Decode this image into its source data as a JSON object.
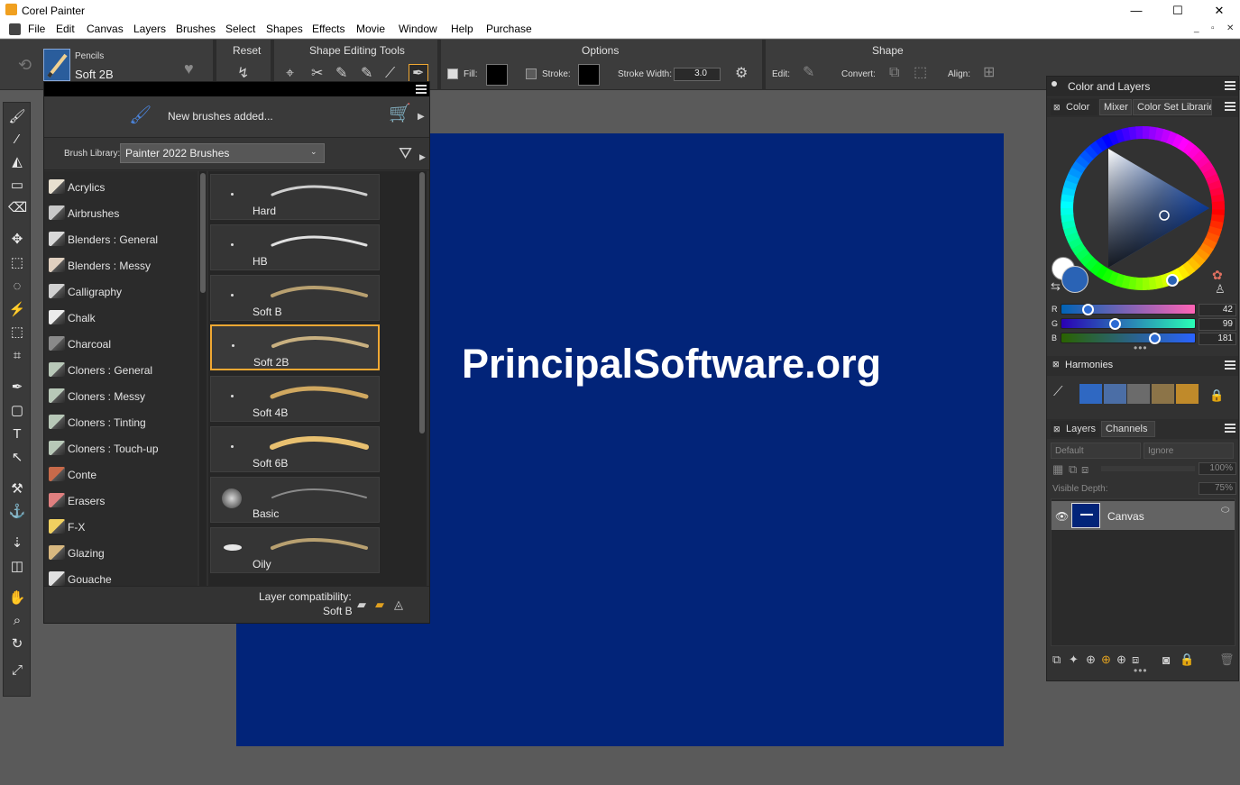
{
  "window": {
    "title": "Corel Painter",
    "minimize": "—",
    "maximize": "☐",
    "close": "✕"
  },
  "menubar": {
    "items": [
      "File",
      "Edit",
      "Canvas",
      "Layers",
      "Brushes",
      "Select",
      "Shapes",
      "Effects",
      "Movie",
      "Window",
      "Help",
      "Purchase"
    ],
    "mdi_buttons": [
      "_",
      "▫",
      "✕"
    ]
  },
  "propbar": {
    "brush_category": "Pencils",
    "brush_variant": "Soft 2B",
    "reset_label": "Reset",
    "shape_tools_label": "Shape Editing Tools",
    "options_label": "Options",
    "fill_label": "Fill:",
    "stroke_label": "Stroke:",
    "stroke_width_label": "Stroke Width:",
    "stroke_width_value": "3.0",
    "shape_label": "Shape",
    "edit_label": "Edit:",
    "convert_label": "Convert:",
    "align_label": "Align:"
  },
  "brush_library": {
    "notice": "New brushes added...",
    "library_label": "Brush Library:",
    "library_value": "Painter 2022 Brushes",
    "categories": [
      {
        "label": "Acrylics",
        "color": "#e8e0d0"
      },
      {
        "label": "Airbrushes",
        "color": "#c8c8c8"
      },
      {
        "label": "Blenders : General",
        "color": "#d8d8d8"
      },
      {
        "label": "Blenders : Messy",
        "color": "#e0d0c0"
      },
      {
        "label": "Calligraphy",
        "color": "#d0d0d0"
      },
      {
        "label": "Chalk",
        "color": "#ececec"
      },
      {
        "label": "Charcoal",
        "color": "#8a8a8a"
      },
      {
        "label": "Cloners : General",
        "color": "#b8c8b8"
      },
      {
        "label": "Cloners : Messy",
        "color": "#b8c8b8"
      },
      {
        "label": "Cloners : Tinting",
        "color": "#b8c8b8"
      },
      {
        "label": "Cloners : Touch-up",
        "color": "#b8c8b8"
      },
      {
        "label": "Conte",
        "color": "#c86a4a"
      },
      {
        "label": "Erasers",
        "color": "#e08080"
      },
      {
        "label": "F-X",
        "color": "#f0d060"
      },
      {
        "label": "Glazing",
        "color": "#d8b880"
      },
      {
        "label": "Gouache",
        "color": "#e0e0e0"
      }
    ],
    "variants": [
      {
        "label": "Hard",
        "stroke": "#cfcfcf"
      },
      {
        "label": "HB",
        "stroke": "#e0e0e0"
      },
      {
        "label": "Soft B",
        "stroke": "#b8a070"
      },
      {
        "label": "Soft 2B",
        "stroke": "#c8b080",
        "selected": true
      },
      {
        "label": "Soft 4B",
        "stroke": "#d0a860"
      },
      {
        "label": "Soft 6B",
        "stroke": "#e8c070"
      },
      {
        "label": "Basic",
        "stroke": "#8a8a8a"
      },
      {
        "label": "Oily",
        "stroke": "#b8a070"
      }
    ],
    "footer_label": "Layer compatibility:",
    "footer_value": "Soft B"
  },
  "canvas": {
    "background": "#022479",
    "text": "PrincipalSoftware.org"
  },
  "color_panel": {
    "title": "Color and Layers",
    "tabs": [
      "Color",
      "Mixer",
      "Color Set Librarie"
    ],
    "r_label": "R",
    "g_label": "G",
    "b_label": "B",
    "r": 42,
    "g": 99,
    "b": 181,
    "current_color": "#2a63b5"
  },
  "harmonies": {
    "title": "Harmonies",
    "swatches": [
      "#2f68c2",
      "#4b6ea6",
      "#6b6b6b",
      "#8c7448",
      "#c08a2a"
    ]
  },
  "layers": {
    "tabs": [
      "Layers",
      "Channels"
    ],
    "composite_method": "Default",
    "preserve": "Ignore",
    "opacity": "100%",
    "visible_depth_label": "Visible Depth:",
    "visible_depth": "75%",
    "items": [
      {
        "name": "Canvas"
      }
    ]
  }
}
